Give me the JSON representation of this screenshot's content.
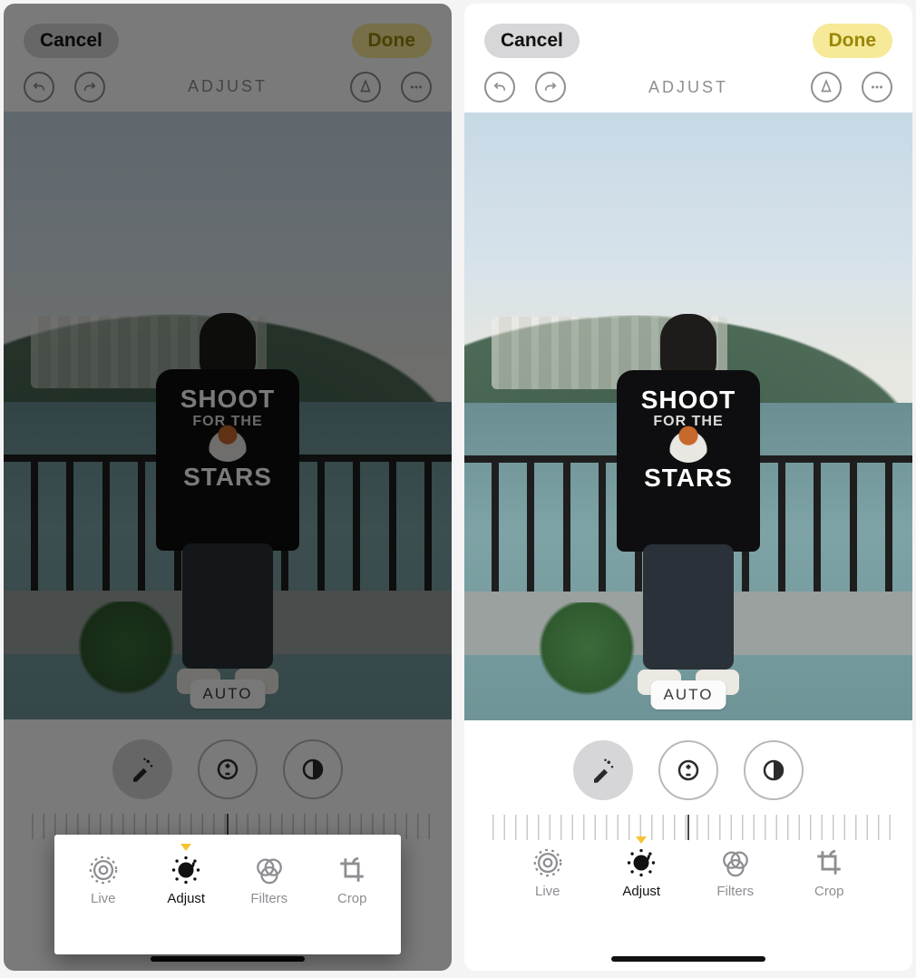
{
  "left": {
    "cancel": "Cancel",
    "done": "Done",
    "mode": "ADJUST",
    "auto_pill": "AUTO",
    "tabs": {
      "live": "Live",
      "adjust": "Adjust",
      "filters": "Filters",
      "crop": "Crop"
    },
    "photo_tshirt": {
      "line1": "SHOOT",
      "line2": "FOR THE",
      "line3": "STARS"
    }
  },
  "right": {
    "cancel": "Cancel",
    "done": "Done",
    "mode": "ADJUST",
    "auto_pill": "AUTO",
    "tabs": {
      "live": "Live",
      "adjust": "Adjust",
      "filters": "Filters",
      "crop": "Crop"
    },
    "photo_tshirt": {
      "line1": "SHOOT",
      "line2": "FOR THE",
      "line3": "STARS"
    }
  },
  "colors": {
    "accent_yellow": "#f5c430",
    "done_bg": "#f6e997",
    "cancel_bg": "#d7d7d9",
    "secondary_text": "#8e8e93"
  }
}
